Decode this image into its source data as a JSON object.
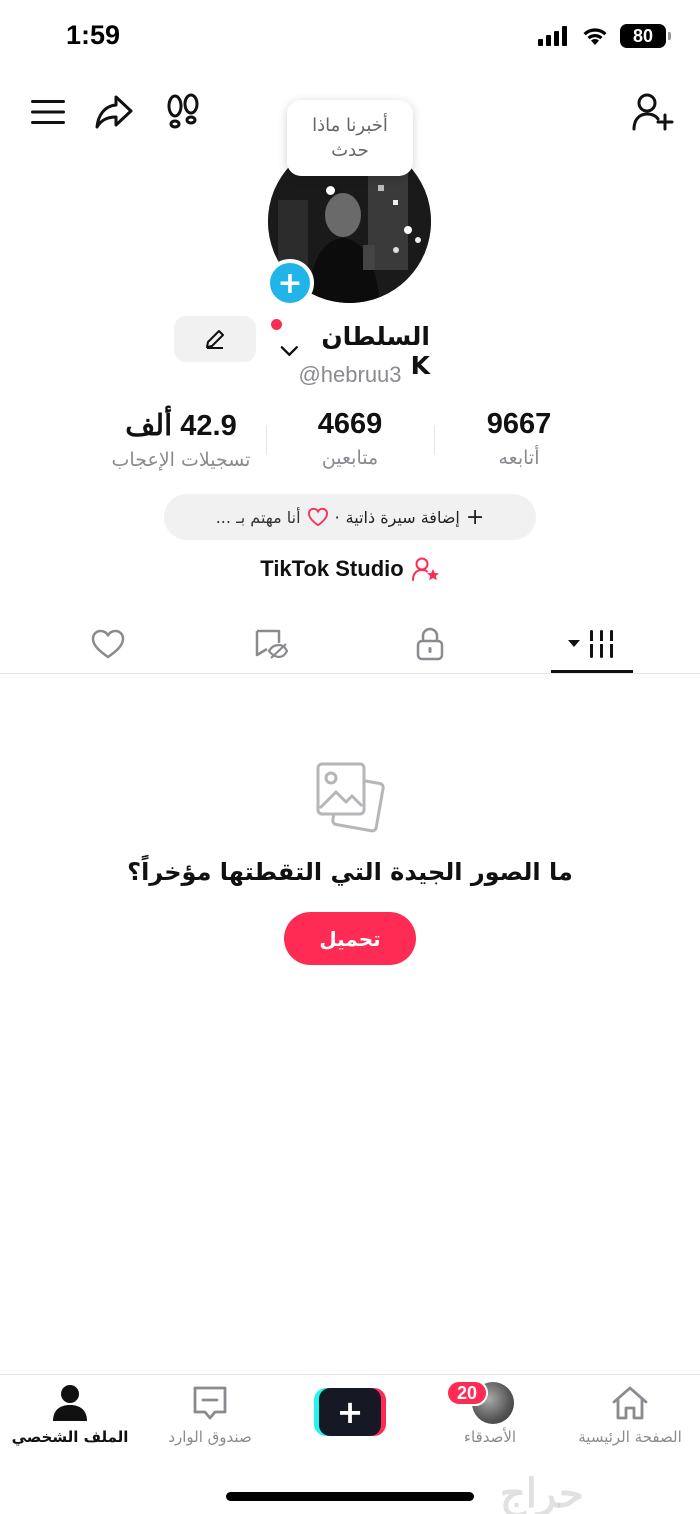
{
  "status_bar": {
    "time": "1:59",
    "battery": "80"
  },
  "tooltip": {
    "text_line1": "أخبرنا ماذا",
    "text_line2": "حدث"
  },
  "profile": {
    "display_name": "السلطان K",
    "username": "@hebruu3"
  },
  "stats": [
    {
      "value": "9667",
      "label": "أتابعه"
    },
    {
      "value": "4669",
      "label": "متابعين"
    },
    {
      "value": "42.9 ألف",
      "label": "تسجيلات الإعجاب"
    }
  ],
  "bio": {
    "add_label": "إضافة سيرة ذاتية",
    "separator": "·",
    "interest_label": "أنا مهتم بـ ..."
  },
  "studio": {
    "label": "TikTok Studio"
  },
  "tabs": [
    {
      "name": "videos",
      "icon": "grid-icon",
      "active": true
    },
    {
      "name": "private",
      "icon": "lock-icon",
      "active": false
    },
    {
      "name": "reposts",
      "icon": "repost-icon",
      "active": false
    },
    {
      "name": "liked",
      "icon": "heart-icon",
      "active": false
    }
  ],
  "empty_state": {
    "title": "ما الصور الجيدة التي التقطتها مؤخراً؟",
    "button": "تحميل"
  },
  "bottom_nav": {
    "home": "الصفحة الرئيسية",
    "friends": "الأصدقاء",
    "friends_badge": "20",
    "inbox": "صندوق الوارد",
    "profile": "الملف الشخصي"
  },
  "watermark": "حراج",
  "colors": {
    "accent": "#fe2c55",
    "plus_blue": "#20b4e8",
    "muted": "#8a8b91"
  }
}
